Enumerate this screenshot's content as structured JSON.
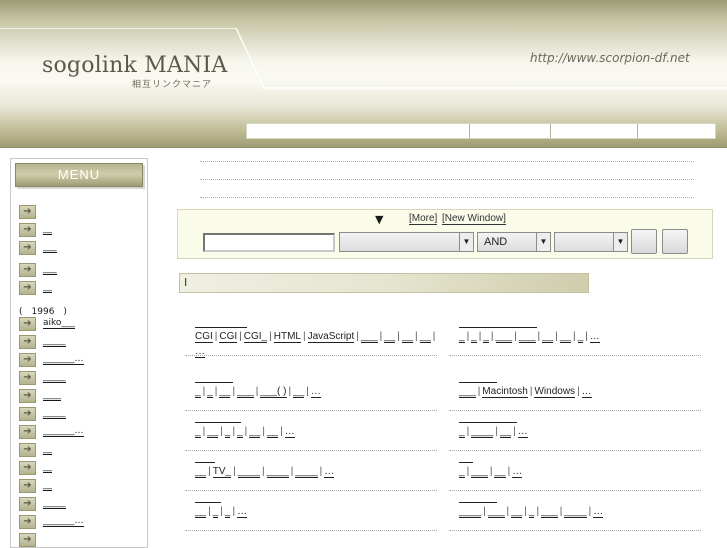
{
  "header": {
    "title": "sogolink MANIA",
    "subtitle": "相互リンクマニア",
    "url": "http://www.scorpion-df.net"
  },
  "menu": {
    "title": "MENU",
    "items": [
      {
        "label": ""
      },
      {
        "label": "__"
      },
      {
        "label": "___"
      },
      {
        "label": "___"
      },
      {
        "label": "__"
      },
      {
        "plain": "(　1996　)"
      },
      {
        "label": "aiko___"
      },
      {
        "label": "_____"
      },
      {
        "label": "_______…"
      },
      {
        "label": "_____"
      },
      {
        "label": "____"
      },
      {
        "label": "_____"
      },
      {
        "label": "_______…"
      },
      {
        "label": "__"
      },
      {
        "label": "__"
      },
      {
        "label": "__"
      },
      {
        "label": "_____"
      },
      {
        "label": "_______…"
      },
      {
        "label": ""
      }
    ]
  },
  "search": {
    "arrow": "▼",
    "more_label": "[More]",
    "new_window_label": "[New Window]",
    "mode_value": "AND"
  },
  "section_title": "I",
  "categories": [
    {
      "links": [
        "CGI",
        "CGI",
        "CGI_",
        "HTML",
        "JavaScript",
        "___",
        "__",
        "__",
        "__",
        "…"
      ]
    },
    {
      "links": [
        "_",
        "_",
        "_",
        "___",
        "___",
        "__",
        "__",
        "_",
        "…"
      ]
    },
    {
      "links": [
        "_",
        "_",
        "__",
        "___",
        "___( )",
        "__",
        "…"
      ]
    },
    {
      "links": [
        "___",
        "Macintosh",
        "Windows",
        "…"
      ]
    },
    {
      "links": [
        "_",
        "__",
        "_",
        "_",
        "__",
        "__",
        "…"
      ]
    },
    {
      "links": [
        "_",
        "____",
        "__",
        "…"
      ]
    },
    {
      "links": [
        "__",
        "TV_",
        "____",
        "____",
        "____",
        "…"
      ]
    },
    {
      "links": [
        "_",
        "___",
        "__",
        "…"
      ]
    },
    {
      "links": [
        "__",
        "_",
        "_",
        "…"
      ]
    },
    {
      "links": [
        "____",
        "___",
        "__",
        "_",
        "___",
        "____",
        "…"
      ]
    }
  ]
}
